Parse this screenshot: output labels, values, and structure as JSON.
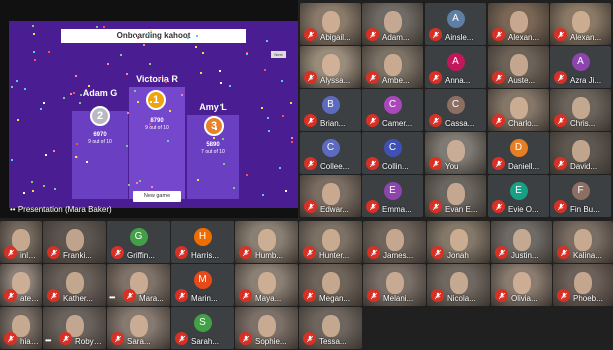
{
  "presentation": {
    "title": "Onboarding kahoot",
    "next_button": "Next",
    "new_game_button": "New game",
    "caption": "Presentation (Mara Baker)",
    "podium": [
      {
        "rank": "2",
        "name": "Adam G",
        "score": "6970",
        "detail": "9 out of 10",
        "medal_color": "#b9b9c4"
      },
      {
        "rank": "1",
        "name": "Victoria R",
        "score": "8790",
        "detail": "9 out of 10",
        "medal_color": "#f0a30a"
      },
      {
        "rank": "3",
        "name": "Amy L",
        "score": "5890",
        "detail": "7 out of 10",
        "medal_color": "#e8822a"
      }
    ]
  },
  "participants": [
    {
      "name": "Abigail...",
      "type": "cam",
      "color": "#8a7a6a"
    },
    {
      "name": "Adam...",
      "type": "cam",
      "color": "#6f6a63"
    },
    {
      "name": "Ainsle...",
      "type": "avatar",
      "initial": "A",
      "color": "#5f7ea3"
    },
    {
      "name": "Alexan...",
      "type": "cam",
      "color": "#7a6655"
    },
    {
      "name": "Alexan...",
      "type": "cam",
      "color": "#8b7966"
    },
    {
      "name": "Alyssa...",
      "type": "cam",
      "color": "#9a8c7b"
    },
    {
      "name": "Ambe...",
      "type": "cam",
      "color": "#7c7266"
    },
    {
      "name": "Anna...",
      "type": "avatar",
      "initial": "A",
      "color": "#c2185b"
    },
    {
      "name": "Auste...",
      "type": "cam",
      "color": "#6c6258"
    },
    {
      "name": "Azra Ji...",
      "type": "avatar",
      "initial": "A",
      "color": "#8e44ad"
    },
    {
      "name": "Brian...",
      "type": "avatar",
      "initial": "B",
      "color": "#5c6bc0"
    },
    {
      "name": "Camer...",
      "type": "avatar",
      "initial": "C",
      "color": "#ab47bc"
    },
    {
      "name": "Cassa...",
      "type": "avatar",
      "initial": "C",
      "color": "#8d6e63"
    },
    {
      "name": "Charlo...",
      "type": "cam",
      "color": "#857768"
    },
    {
      "name": "Chris...",
      "type": "cam",
      "color": "#6a645c"
    },
    {
      "name": "Collee...",
      "type": "avatar",
      "initial": "C",
      "color": "#5c6bc0"
    },
    {
      "name": "Collin...",
      "type": "avatar",
      "initial": "C",
      "color": "#3f51b5"
    },
    {
      "name": "You",
      "type": "cam",
      "color": "#7f7a74"
    },
    {
      "name": "Daniell...",
      "type": "avatar",
      "initial": "D",
      "color": "#e67e22"
    },
    {
      "name": "David...",
      "type": "cam",
      "color": "#5e5750"
    },
    {
      "name": "Edwar...",
      "type": "cam",
      "color": "#7b6d62"
    },
    {
      "name": "Emma...",
      "type": "avatar",
      "initial": "E",
      "color": "#8e44ad"
    },
    {
      "name": "Evan E...",
      "type": "cam",
      "color": "#6b6560"
    },
    {
      "name": "Evie O...",
      "type": "avatar",
      "initial": "E",
      "color": "#16a085"
    },
    {
      "name": "Fin Bu...",
      "type": "avatar",
      "initial": "F",
      "color": "#8d6e63"
    },
    {
      "name": "inley...",
      "type": "cam",
      "color": "#74695e"
    },
    {
      "name": "Franki...",
      "type": "cam",
      "color": "#5d5550"
    },
    {
      "name": "Griffin...",
      "type": "avatar",
      "initial": "G",
      "color": "#43a047"
    },
    {
      "name": "Harris...",
      "type": "avatar",
      "initial": "H",
      "color": "#ef6c00"
    },
    {
      "name": "Humb...",
      "type": "cam",
      "color": "#8a7f73"
    },
    {
      "name": "Hunter...",
      "type": "cam",
      "color": "#7d7165"
    },
    {
      "name": "James...",
      "type": "cam",
      "color": "#6f655c"
    },
    {
      "name": "Jonah",
      "type": "cam",
      "color": "#847869"
    },
    {
      "name": "Justin...",
      "type": "cam",
      "color": "#6e6a66"
    },
    {
      "name": "Kalina...",
      "type": "cam",
      "color": "#7a6e64"
    },
    {
      "name": "ate R...",
      "type": "cam",
      "color": "#8a8078"
    },
    {
      "name": "Kather...",
      "type": "cam",
      "color": "#6a605a"
    },
    {
      "name": "Mara...",
      "type": "cam",
      "color": "#7f7268"
    },
    {
      "name": "Marin...",
      "type": "avatar",
      "initial": "M",
      "color": "#e64a19"
    },
    {
      "name": "Maya...",
      "type": "cam",
      "color": "#8c8074"
    },
    {
      "name": "Megan...",
      "type": "cam",
      "color": "#6f645a"
    },
    {
      "name": "Melani...",
      "type": "cam",
      "color": "#7b7068"
    },
    {
      "name": "Nicola...",
      "type": "cam",
      "color": "#706860"
    },
    {
      "name": "Olivia...",
      "type": "cam",
      "color": "#8a7c70"
    },
    {
      "name": "Phoeb...",
      "type": "cam",
      "color": "#6c6058"
    },
    {
      "name": "hiann...",
      "type": "cam",
      "color": "#766c64"
    },
    {
      "name": "Robyn...",
      "type": "cam",
      "color": "#6a625c"
    },
    {
      "name": "Sara...",
      "type": "cam",
      "color": "#857970"
    },
    {
      "name": "Sarah...",
      "type": "avatar",
      "initial": "S",
      "color": "#43a047"
    },
    {
      "name": "Sophie...",
      "type": "cam",
      "color": "#7c7068"
    },
    {
      "name": "Tessa...",
      "type": "cam",
      "color": "#6e665e"
    }
  ]
}
